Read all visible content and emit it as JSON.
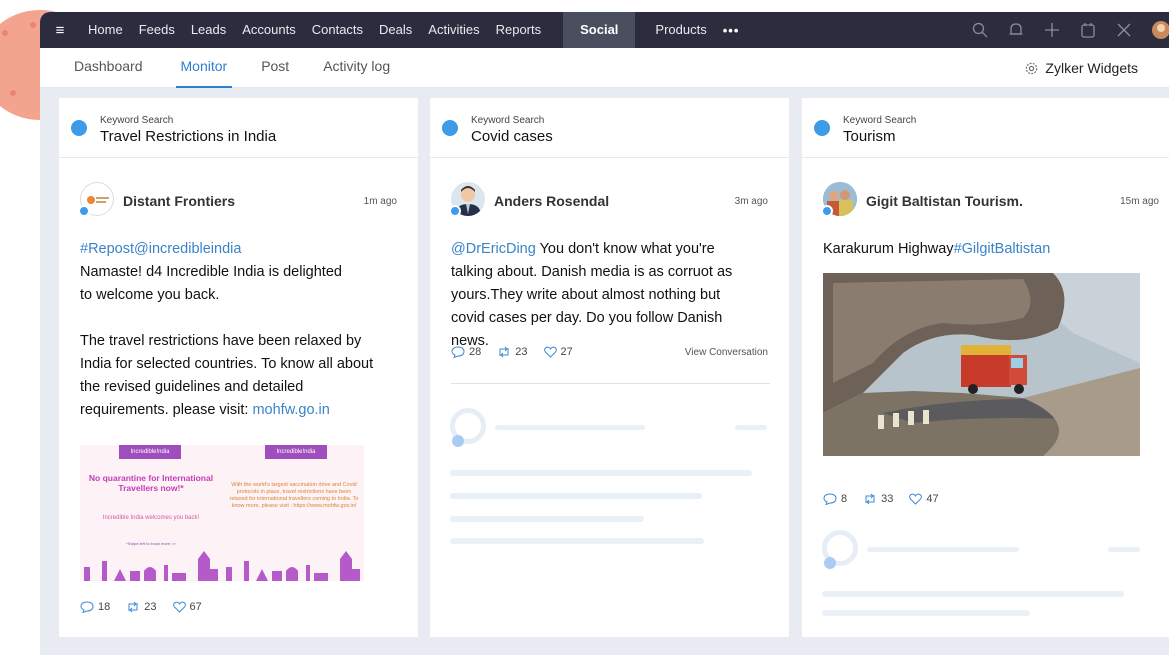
{
  "topnav": {
    "items": [
      "Home",
      "Feeds",
      "Leads",
      "Accounts",
      "Contacts",
      "Deals",
      "Activities",
      "Reports"
    ],
    "active": "Social",
    "products": "Products",
    "more": "•••"
  },
  "subnav": {
    "tabs": [
      "Dashboard",
      "Monitor",
      "Post",
      "Activity log"
    ],
    "active_tab": "Monitor",
    "widgets": "Zylker Widgets"
  },
  "columns": [
    {
      "keyword_label": "Keyword Search",
      "keyword": "Travel Restrictions in India",
      "post": {
        "author": "Distant Frontiers",
        "time": "1m ago",
        "text_link": "#Repost@incredibleindia",
        "text_lines": [
          "Namaste! d4 Incredible India is delighted",
          "to welcome you back.",
          "",
          "The travel restrictions have been relaxed by",
          "India for selected countries. To know all about",
          "the revised guidelines and detailed",
          "requirements. please visit: "
        ],
        "text_tail_link": "mohfw.go.in",
        "image_left_heading": "No quarantine for International Travellers now!*",
        "image_left_sub": "Incredible India welcomes you back!",
        "image_right_heading": "With the world's largest vaccination drive and Covid protocols in place, travel restrictions have been relaxed for international travellers coming to India. To know more, please visit : https://www.mohfw.gov.in/",
        "image_banner": "Incredible!ndia",
        "image_footnote": "*Swipe left to know more >>",
        "replies": "18",
        "retweets": "23",
        "likes": "67"
      }
    },
    {
      "keyword_label": "Keyword Search",
      "keyword": "Covid cases",
      "post": {
        "author": "Anders Rosendal",
        "time": "3m ago",
        "text_link": "@DrEricDing",
        "text": " You don't know what you're talking about. Danish media is as corruot as yours.They write about almost nothing but covid cases per day. Do you follow Danish news.",
        "replies": "28",
        "retweets": "23",
        "likes": "27",
        "view_conversation": "View Conversation"
      }
    },
    {
      "keyword_label": "Keyword Search",
      "keyword": "Tourism",
      "post": {
        "author": "Gigit Baltistan Tourism.",
        "time": "15m ago",
        "text": "Karakurum Highway",
        "text_link": "#GilgitBaltistan",
        "replies": "8",
        "retweets": "33",
        "likes": "47"
      }
    }
  ],
  "colors": {
    "nav_bg": "#2b2d3f",
    "accent": "#2f7fd1",
    "twitter": "#3d9be9",
    "link": "#3a83c9"
  }
}
